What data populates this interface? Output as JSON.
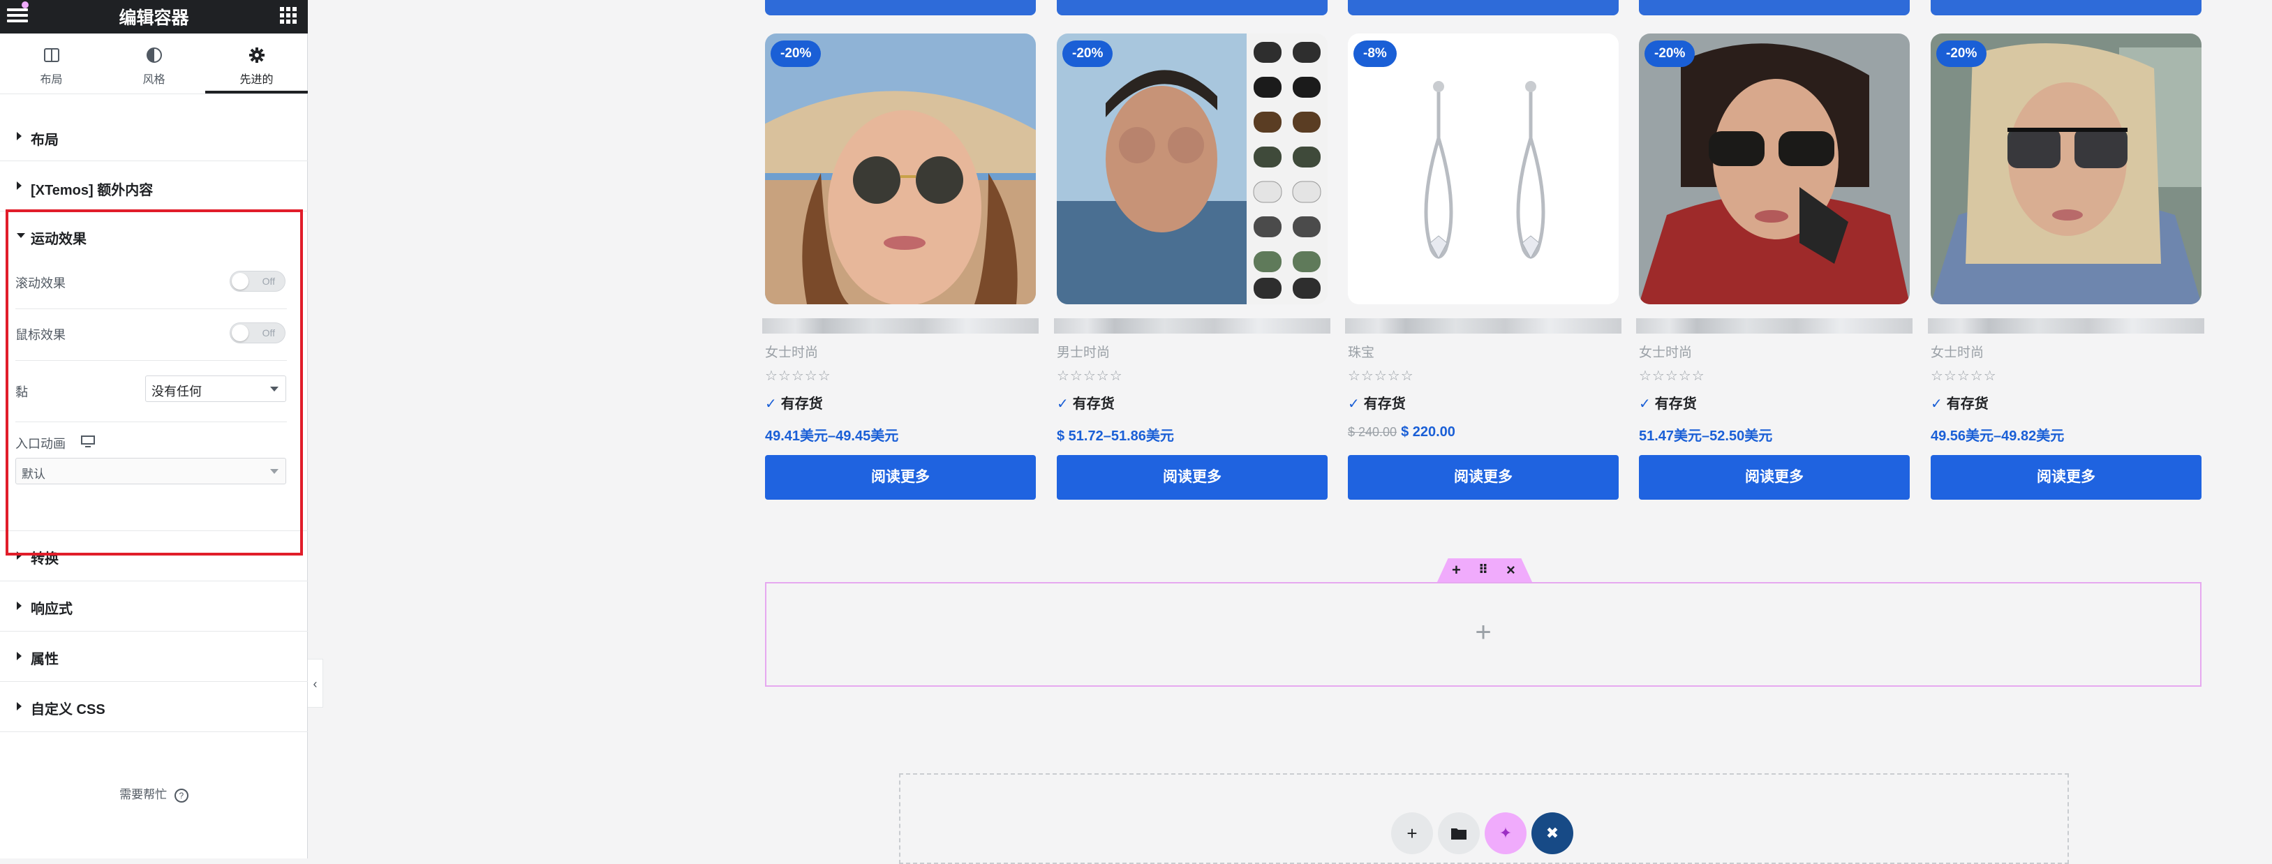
{
  "editor": {
    "title": "编辑容器",
    "tabs": [
      {
        "label": "布局",
        "icon": "layout-icon"
      },
      {
        "label": "风格",
        "icon": "style-icon"
      },
      {
        "label": "先进的",
        "icon": "gear-icon"
      }
    ],
    "active_tab": "先进的",
    "sections": {
      "layout": "布局",
      "xtemos": "[XTemos] 额外内容",
      "motion": "运动效果",
      "transform": "转换",
      "responsive": "响应式",
      "attributes": "属性",
      "custom_css": "自定义 CSS"
    },
    "motion": {
      "scroll_label": "滚动效果",
      "scroll_state": "Off",
      "mouse_label": "鼠标效果",
      "mouse_state": "Off",
      "sticky_label": "黏",
      "sticky_value": "没有任何",
      "entrance_label": "入口动画",
      "entrance_value": "默认"
    },
    "help": "需要帮忙"
  },
  "products": [
    {
      "badge": "-20%",
      "category": "女士时尚",
      "stock": "有存货",
      "price": "49.41美元–49.45美元",
      "old_price": "",
      "button": "阅读更多",
      "rating": 0
    },
    {
      "badge": "-20%",
      "category": "男士时尚",
      "stock": "有存货",
      "price": "$ 51.72–51.86美元",
      "old_price": "",
      "button": "阅读更多",
      "rating": 0
    },
    {
      "badge": "-8%",
      "category": "珠宝",
      "stock": "有存货",
      "price": "$ 220.00",
      "old_price": "$ 240.00",
      "button": "阅读更多",
      "rating": 0
    },
    {
      "badge": "-20%",
      "category": "女士时尚",
      "stock": "有存货",
      "price": "51.47美元–52.50美元",
      "old_price": "",
      "button": "阅读更多",
      "rating": 0
    },
    {
      "badge": "-20%",
      "category": "女士时尚",
      "stock": "有存货",
      "price": "49.56美元–49.82美元",
      "old_price": "",
      "button": "阅读更多",
      "rating": 0
    }
  ],
  "rating_stars": "☆☆☆☆☆",
  "colors": {
    "accent": "#1f63e0",
    "badge": "#1a5fd6",
    "highlight_border": "#e11d2a",
    "container_handle": "#f0abfc"
  },
  "canvas": {
    "add_glyph": "+"
  }
}
